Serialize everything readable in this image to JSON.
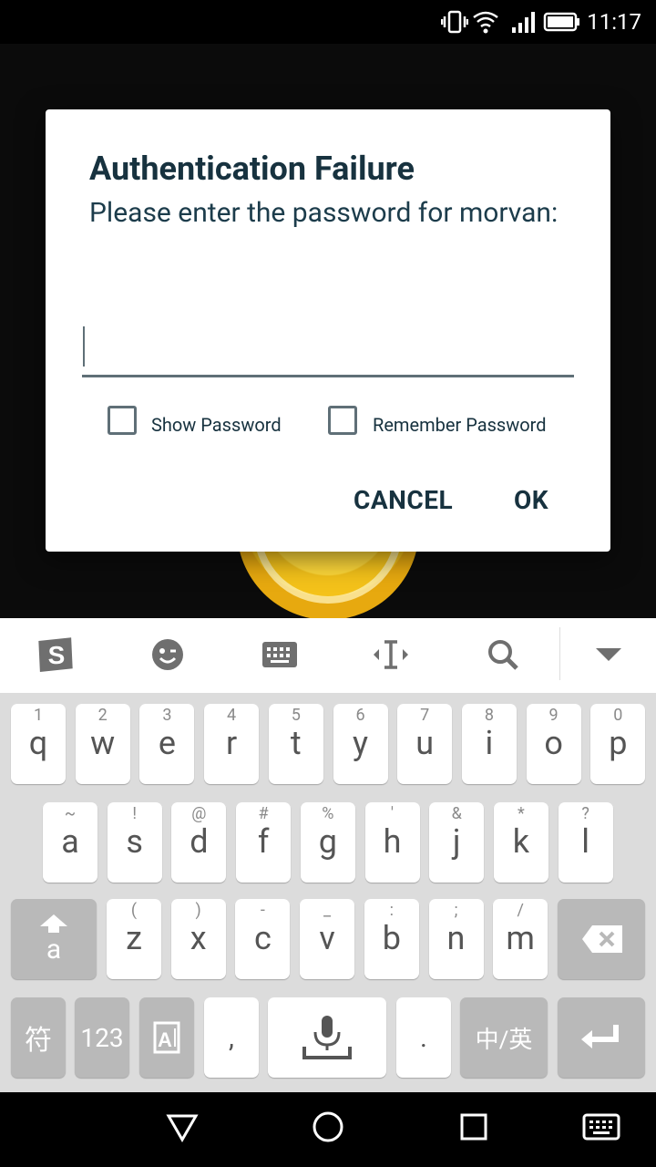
{
  "status_bar": {
    "time": "11:17",
    "icons": [
      "vibrate-icon",
      "wifi-icon",
      "signal-icon",
      "battery-icon"
    ]
  },
  "dialog": {
    "title": "Authentication Failure",
    "message": "Please enter the password for morvan:",
    "password_value": "",
    "show_password_label": "Show Password",
    "show_password_checked": false,
    "remember_password_label": "Remember Password",
    "remember_password_checked": false,
    "cancel_label": "CANCEL",
    "ok_label": "OK"
  },
  "keyboard_toolbar": {
    "items": [
      "sogou-logo-icon",
      "emoji-icon",
      "keyboard-icon",
      "cursor-move-icon",
      "search-icon",
      "collapse-keyboard-icon"
    ]
  },
  "keyboard": {
    "row1": [
      {
        "hint": "1",
        "key": "q"
      },
      {
        "hint": "2",
        "key": "w"
      },
      {
        "hint": "3",
        "key": "e"
      },
      {
        "hint": "4",
        "key": "r"
      },
      {
        "hint": "5",
        "key": "t"
      },
      {
        "hint": "6",
        "key": "y"
      },
      {
        "hint": "7",
        "key": "u"
      },
      {
        "hint": "8",
        "key": "i"
      },
      {
        "hint": "9",
        "key": "o"
      },
      {
        "hint": "0",
        "key": "p"
      }
    ],
    "row2": [
      {
        "hint": "~",
        "key": "a"
      },
      {
        "hint": "!",
        "key": "s"
      },
      {
        "hint": "@",
        "key": "d"
      },
      {
        "hint": "#",
        "key": "f"
      },
      {
        "hint": "%",
        "key": "g"
      },
      {
        "hint": "'",
        "key": "h"
      },
      {
        "hint": "&",
        "key": "j"
      },
      {
        "hint": "*",
        "key": "k"
      },
      {
        "hint": "?",
        "key": "l"
      }
    ],
    "row3": [
      {
        "hint": "(",
        "key": "z"
      },
      {
        "hint": ")",
        "key": "x"
      },
      {
        "hint": "-",
        "key": "c"
      },
      {
        "hint": "_",
        "key": "v"
      },
      {
        "hint": ":",
        "key": "b"
      },
      {
        "hint": ";",
        "key": "n"
      },
      {
        "hint": "/",
        "key": "m"
      }
    ],
    "shift_label": "a",
    "symbols_label": "符",
    "numbers_label": "123",
    "comma_label": ",",
    "period_label": ".",
    "lang_label": "中/英"
  },
  "nav_bar": {
    "items": [
      "back-icon",
      "home-icon",
      "recents-icon",
      "keyboard-switch-icon"
    ]
  }
}
